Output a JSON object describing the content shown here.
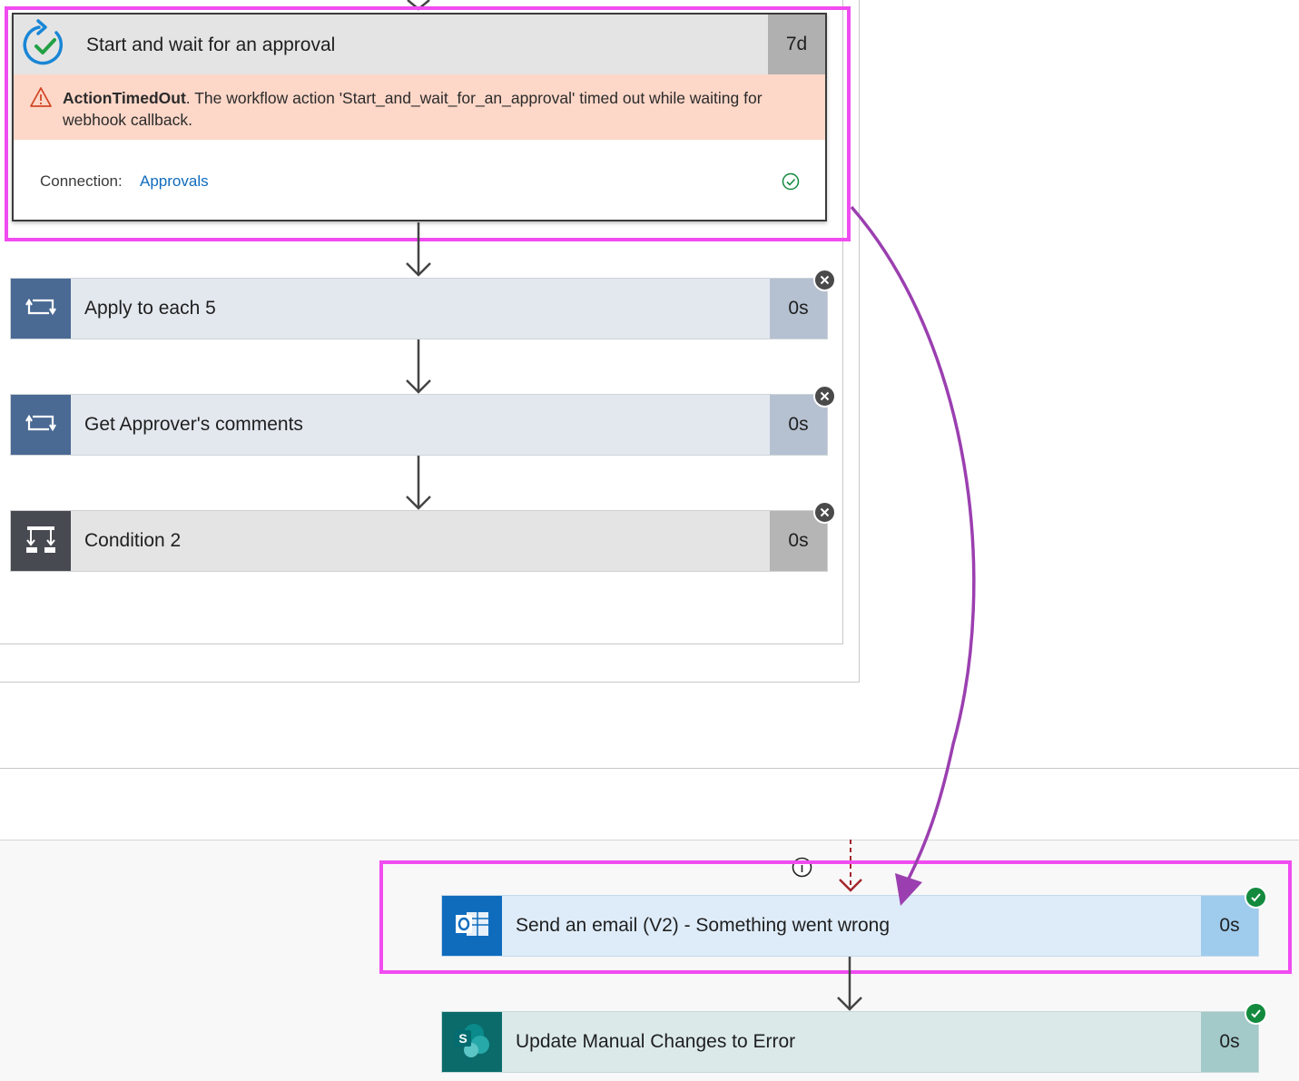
{
  "approval": {
    "title": "Start and wait for an approval",
    "duration": "7d",
    "error_code": "ActionTimedOut",
    "error_message": ". The workflow action 'Start_and_wait_for_an_approval' timed out while waiting for webhook callback.",
    "connection_label": "Connection:",
    "connection_value": "Approvals",
    "icon": "approval-icon"
  },
  "steps": [
    {
      "title": "Apply to each 5",
      "duration": "0s",
      "icon": "loop-icon",
      "status": "cancelled"
    },
    {
      "title": "Get Approver's comments",
      "duration": "0s",
      "icon": "loop-icon",
      "status": "cancelled"
    },
    {
      "title": "Condition 2",
      "duration": "0s",
      "icon": "condition-icon",
      "status": "cancelled"
    }
  ],
  "error_branch": [
    {
      "title": "Send an email (V2) - Something went wrong",
      "duration": "0s",
      "icon": "outlook-icon",
      "status": "succeeded"
    },
    {
      "title": "Update Manual Changes to Error",
      "duration": "0s",
      "icon": "sharepoint-icon",
      "status": "succeeded"
    }
  ],
  "colors": {
    "highlight": "#f04cf0",
    "annotation_arrow": "#9b3fb0",
    "error_bg": "#fdd7c8",
    "loop_header": "#4a6a94",
    "condition_header": "#474a51",
    "outlook_blue": "#0f6cbd",
    "sharepoint_teal": "#0b6a6a",
    "success_green": "#138a3e"
  }
}
